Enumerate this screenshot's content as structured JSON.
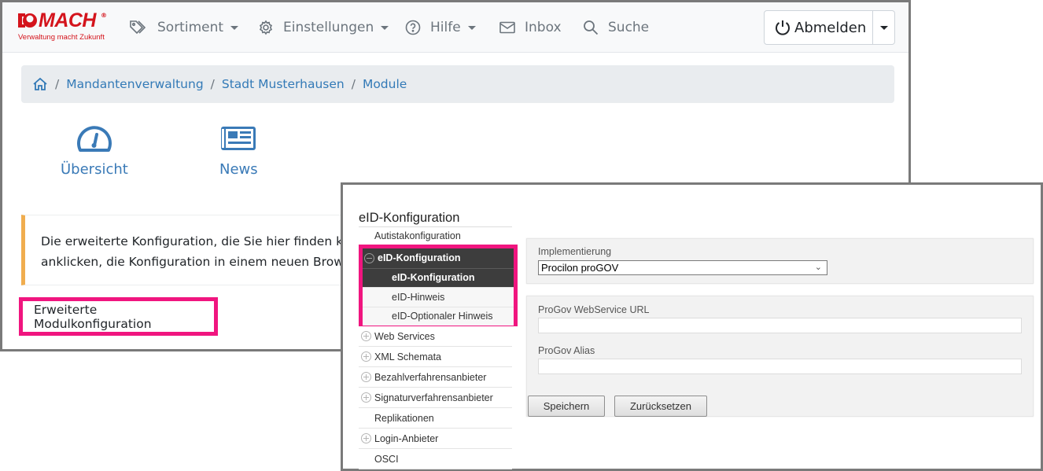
{
  "back_window": {
    "logo": {
      "name": "MACH",
      "registered": "®",
      "tagline": "Verwaltung macht Zukunft",
      "brand_color": "#d4141c"
    },
    "nav": [
      {
        "label": "Sortiment",
        "icon": "tags-icon",
        "dropdown": true
      },
      {
        "label": "Einstellungen",
        "icon": "gear-icon",
        "dropdown": true
      },
      {
        "label": "Hilfe",
        "icon": "question-circle-icon",
        "dropdown": true
      },
      {
        "label": "Inbox",
        "icon": "envelope-icon",
        "dropdown": false
      },
      {
        "label": "Suche",
        "icon": "search-icon",
        "dropdown": false
      }
    ],
    "logout": {
      "label": "Abmelden",
      "icon": "power-icon"
    },
    "breadcrumb": {
      "home_icon": "home-icon",
      "separator": "/",
      "items": [
        "Mandantenverwaltung",
        "Stadt Musterhausen",
        "Module"
      ]
    },
    "tiles": [
      {
        "label": "Übersicht",
        "icon": "dashboard-gauge-icon"
      },
      {
        "label": "News",
        "icon": "newspaper-icon"
      }
    ],
    "alert": {
      "line1": "Die erweiterte Konfiguration, die Sie hier finden könne",
      "line2": "anklicken, die Konfiguration in einem neuen Browserta",
      "accent_color": "#f0ad4e"
    },
    "extended_button": {
      "label": "Erweiterte Modulkonfiguration",
      "highlight_color": "#f0157f"
    }
  },
  "front_window": {
    "title": "eID-Konfiguration",
    "menu_top": [
      {
        "label": "Autistakonfiguration"
      }
    ],
    "menu_group": {
      "label": "eID-Konfiguration",
      "expanded": true,
      "children": [
        {
          "label": "eID-Konfiguration",
          "active": true
        },
        {
          "label": "eID-Hinweis",
          "active": false
        },
        {
          "label": "eID-Optionaler Hinweis",
          "active": false
        }
      ]
    },
    "menu_bottom": [
      {
        "label": "Web Services",
        "expandable": true
      },
      {
        "label": "XML Schemata",
        "expandable": true
      },
      {
        "label": "Bezahlverfahrensanbieter",
        "expandable": true
      },
      {
        "label": "Signaturverfahrensanbieter",
        "expandable": true
      },
      {
        "label": "Replikationen",
        "expandable": false
      },
      {
        "label": "Login-Anbieter",
        "expandable": true
      },
      {
        "label": "OSCI",
        "expandable": false
      }
    ],
    "form": {
      "implementation_label": "Implementierung",
      "implementation_value": "Procilon proGOV",
      "url_label": "ProGov WebService URL",
      "url_value": "",
      "alias_label": "ProGov Alias",
      "alias_value": "",
      "save_label": "Speichern",
      "reset_label": "Zurücksetzen"
    }
  }
}
